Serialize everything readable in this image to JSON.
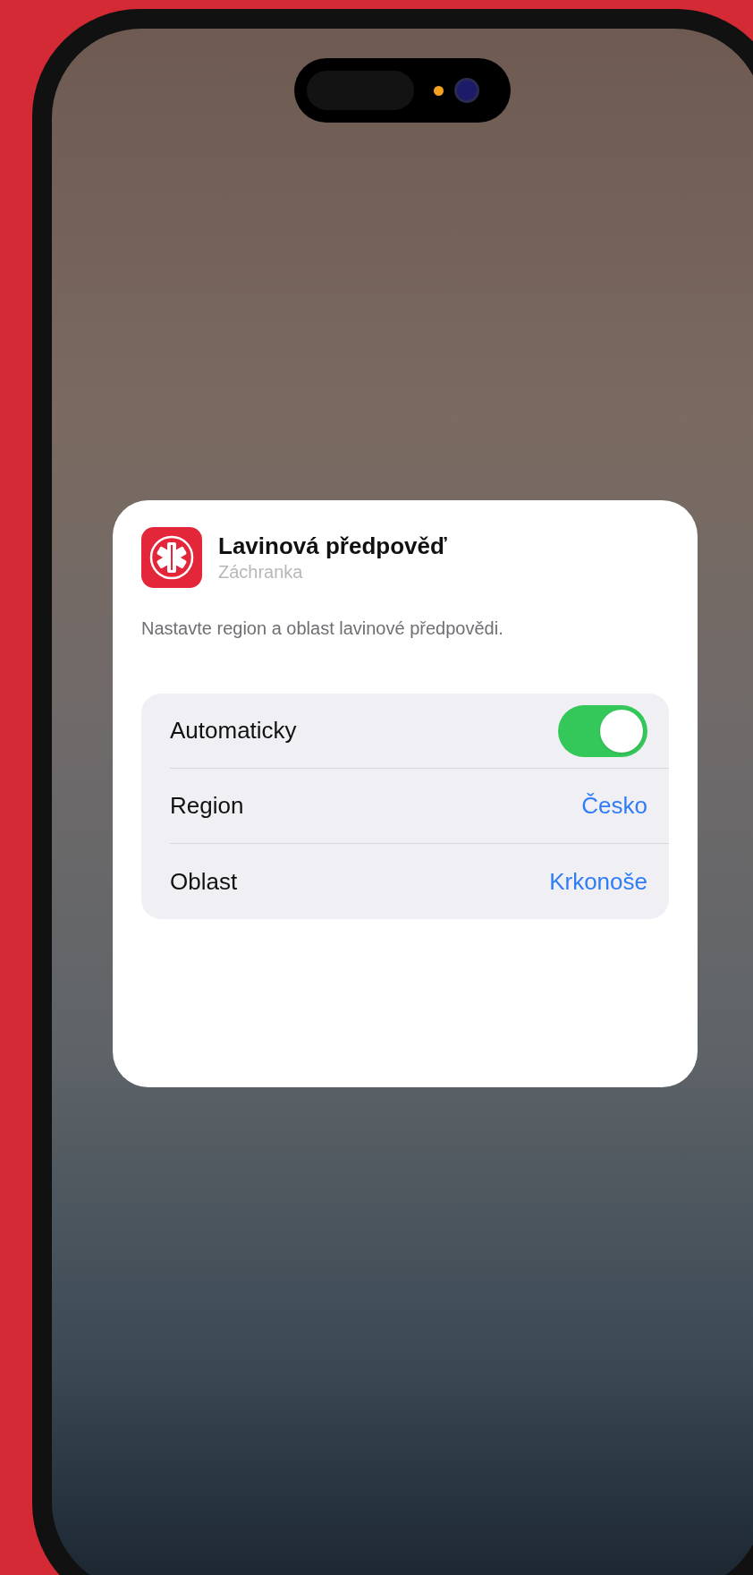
{
  "widget": {
    "title": "Lavinová předpověď",
    "subtitle": "Záchranka",
    "description": "Nastavte region a oblast lavinové předpovědi.",
    "settings": [
      {
        "kind": "toggle",
        "label": "Automaticky",
        "on": true
      },
      {
        "kind": "value",
        "label": "Region",
        "value": "Česko"
      },
      {
        "kind": "value",
        "label": "Oblast",
        "value": "Krkonoše"
      }
    ]
  }
}
